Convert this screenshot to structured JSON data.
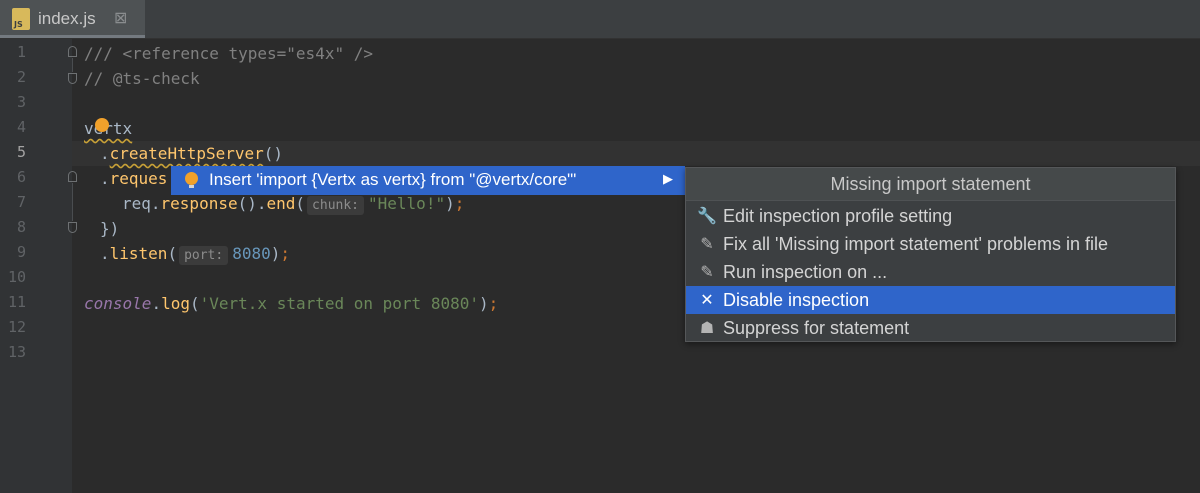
{
  "tab": {
    "icon_text": "JS",
    "title": "index.js",
    "close": "⊠"
  },
  "gutter": {
    "line_numbers": [
      "1",
      "2",
      "3",
      "4",
      "5",
      "6",
      "7",
      "8",
      "9",
      "10",
      "11",
      "12",
      "13"
    ],
    "active_line": "5"
  },
  "code": {
    "l1": "/// <reference types=\"es4x\" />",
    "l2": "// @ts-check",
    "l4": "vertx",
    "l5_dot": ".",
    "l5_fn": "createHttpServer",
    "l5_paren": "()",
    "l6_dot": ".",
    "l6_fn": "reques",
    "l7_indent": "req.",
    "l7_fn1": "response",
    "l7_mid": "().",
    "l7_fn2": "end",
    "l7_open": "(",
    "l7_hint": "chunk:",
    "l7_str": "\"Hello!\"",
    "l7_close": ")",
    "l7_semi": ";",
    "l8": "})",
    "l9_dot": ".",
    "l9_fn": "listen",
    "l9_open": "(",
    "l9_hint": "port:",
    "l9_num": "8080",
    "l9_close": ")",
    "l9_semi": ";",
    "l11_obj": "console",
    "l11_dot": ".",
    "l11_fn": "log",
    "l11_open": "(",
    "l11_str": "'Vert.x started on port 8080'",
    "l11_close": ")",
    "l11_semi": ";"
  },
  "intention": {
    "label": "Insert 'import {Vertx as vertx} from \"@vertx/core\"'",
    "arrow": "▶"
  },
  "submenu": {
    "title": "Missing import statement",
    "items": [
      {
        "icon": "🔧",
        "label": "Edit inspection profile setting"
      },
      {
        "icon": "✎",
        "label": "Fix all 'Missing import statement' problems in file"
      },
      {
        "icon": "✎",
        "label": "Run inspection on ..."
      },
      {
        "icon": "✕",
        "label": "Disable inspection"
      },
      {
        "icon": "☗",
        "label": "Suppress for statement"
      }
    ],
    "selected_index": 3
  },
  "colors": {
    "editor_bg": "#2b2b2b",
    "gutter_bg": "#313335",
    "selection_blue": "#2f65ca",
    "keyword_orange": "#cc7832",
    "function_yellow": "#ffc66d",
    "string_green": "#6a8759",
    "number_blue": "#6897bb",
    "global_purple": "#9876aa"
  }
}
